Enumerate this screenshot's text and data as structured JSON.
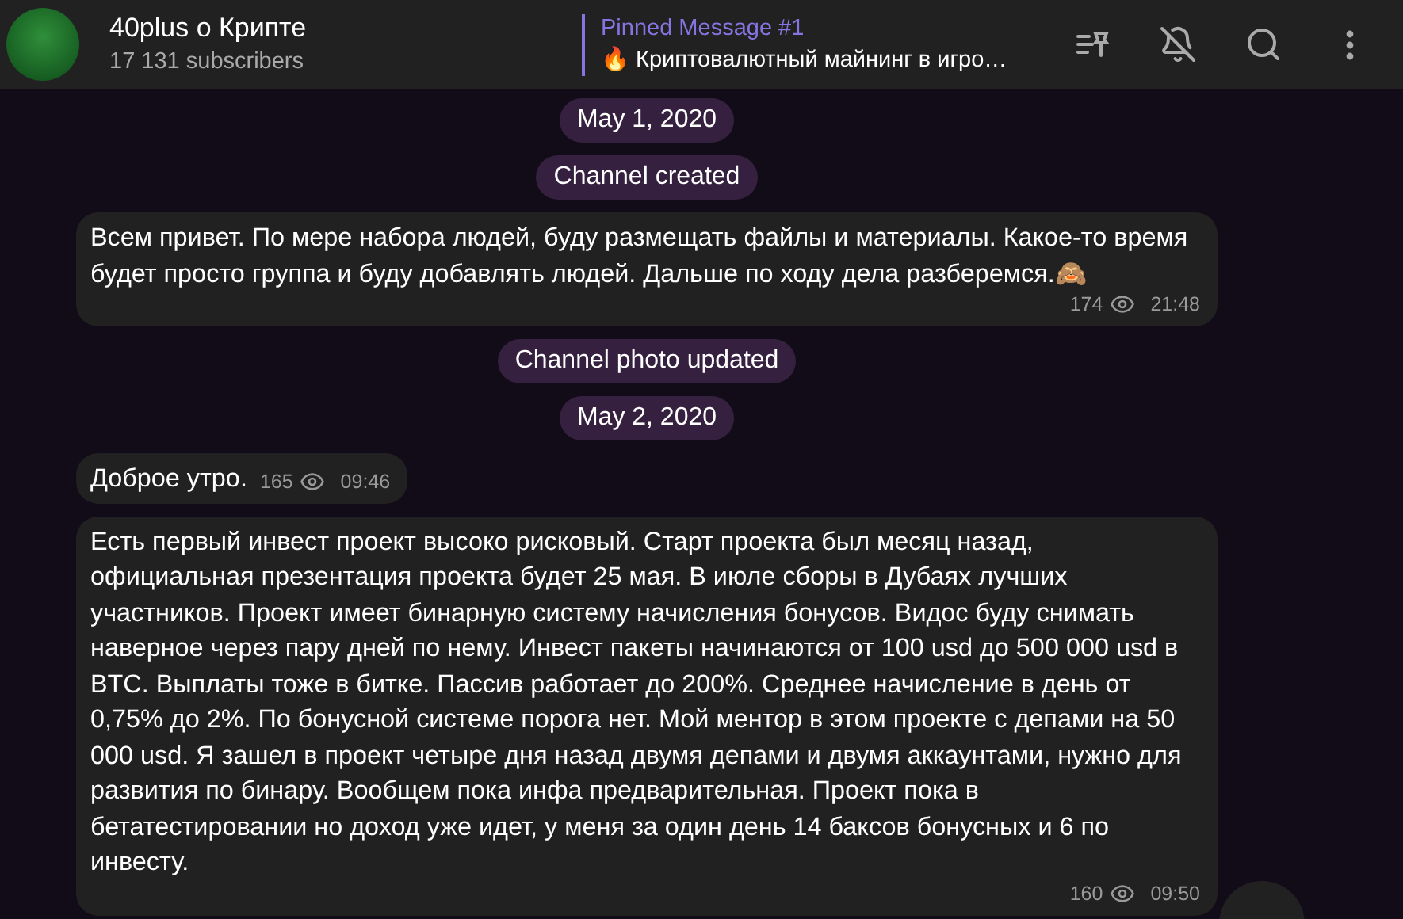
{
  "header": {
    "title": "40plus о Крипте",
    "subscribers": "17 131 subscribers",
    "pinned": {
      "title": "Pinned Message #1",
      "emoji": "🔥",
      "text": "Криптовалютный майнинг в игро…"
    }
  },
  "feed": [
    {
      "kind": "service",
      "text": "May 1, 2020"
    },
    {
      "kind": "service",
      "text": "Channel created"
    },
    {
      "kind": "message",
      "text": "Всем привет. По мере набора людей, буду размещать файлы и материалы. Какое-то время будет просто группа и буду добавлять людей. Дальше по ходу дела разберемся.🙈",
      "views": "174",
      "time": "21:48"
    },
    {
      "kind": "service",
      "text": "Channel photo updated"
    },
    {
      "kind": "service",
      "text": "May 2, 2020"
    },
    {
      "kind": "message",
      "text": "Доброе утро.",
      "views": "165",
      "time": "09:46"
    },
    {
      "kind": "message",
      "text": "Есть первый инвест проект высоко рисковый. Старт проекта был месяц назад, официальная презентация проекта будет 25 мая. В июле сборы в Дубаях лучших участников. Проект имеет бинарную систему начисления бонусов. Видос буду снимать наверное через пару дней по нему. Инвест пакеты начинаются от 100 usd до 500 000 usd в BTC. Выплаты тоже в битке. Пассив работает до 200%. Среднее начисление в день от 0,75% до 2%. По бонусной системе порога нет. Мой ментор в этом проекте с депами на 50 000 usd. Я зашел в проект четыре дня назад двумя депами и двумя аккаунтами, нужно для развития по бинару. Вообщем пока инфа предварительная. Проект пока в бетатестировании но доход уже идет, у меня за один день 14 баксов бонусных и 6 по инвесту.",
      "views": "160",
      "time": "09:50"
    }
  ]
}
